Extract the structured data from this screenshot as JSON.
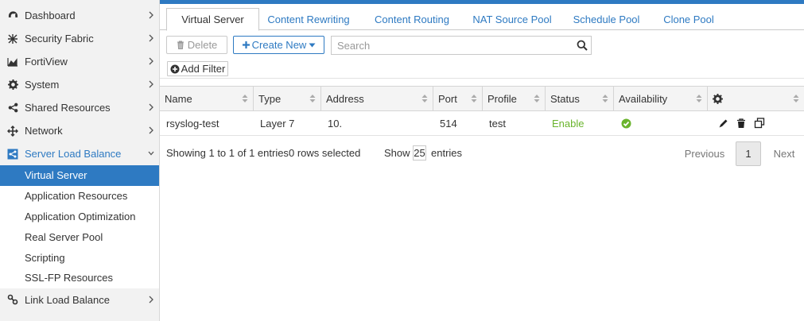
{
  "sidebar": {
    "items": [
      {
        "label": "Dashboard",
        "icon": "dashboard-icon"
      },
      {
        "label": "Security Fabric",
        "icon": "security-fabric-icon"
      },
      {
        "label": "FortiView",
        "icon": "fortiview-icon"
      },
      {
        "label": "System",
        "icon": "gear-icon"
      },
      {
        "label": "Shared Resources",
        "icon": "share-icon"
      },
      {
        "label": "Network",
        "icon": "network-icon"
      },
      {
        "label": "Server Load Balance",
        "icon": "server-load-balance-icon"
      }
    ],
    "sub_items": [
      "Virtual Server",
      "Application Resources",
      "Application Optimization",
      "Real Server Pool",
      "Scripting",
      "SSL-FP Resources"
    ],
    "after_items": [
      {
        "label": "Link Load Balance",
        "icon": "link-icon"
      }
    ]
  },
  "tabs": [
    "Virtual Server",
    "Content Rewriting",
    "Content Routing",
    "NAT Source Pool",
    "Schedule Pool",
    "Clone Pool"
  ],
  "toolbar": {
    "delete_label": "Delete",
    "create_label": "Create New",
    "search_placeholder": "Search",
    "add_filter_label": "Add Filter"
  },
  "table": {
    "columns": [
      "Name",
      "Type",
      "Address",
      "Port",
      "Profile",
      "Status",
      "Availability"
    ],
    "rows": [
      {
        "name": "rsyslog-test",
        "type": "Layer 7",
        "address": "10.",
        "port": "514",
        "profile": "test",
        "status": "Enable"
      }
    ]
  },
  "footer": {
    "showing": "Showing 1 to 1 of 1 entries",
    "selected": "0 rows selected",
    "show_label": "Show",
    "show_count": "25",
    "entries_label": "entries",
    "previous": "Previous",
    "page": "1",
    "next": "Next"
  },
  "colors": {
    "accent": "#2e7ac2",
    "status_enable": "#6ab42d",
    "availability_ok": "#6ab42d"
  }
}
